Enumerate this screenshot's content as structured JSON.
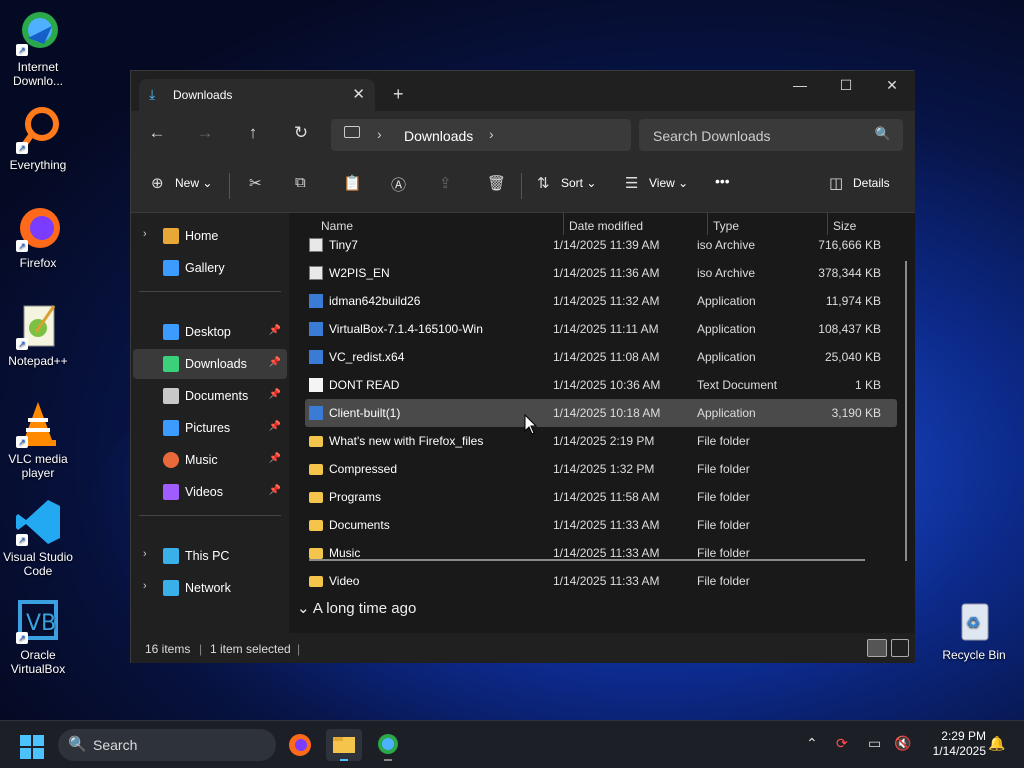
{
  "desktop": {
    "icons": [
      {
        "label": "Internet Downlo...",
        "icon": "internet-download-manager-icon"
      },
      {
        "label": "Everything",
        "icon": "everything-search-icon"
      },
      {
        "label": "Firefox",
        "icon": "firefox-icon"
      },
      {
        "label": "Notepad++",
        "icon": "notepad-plus-plus-icon"
      },
      {
        "label": "VLC media player",
        "icon": "vlc-icon"
      },
      {
        "label": "Visual Studio Code",
        "icon": "vscode-icon"
      },
      {
        "label": "Oracle VirtualBox",
        "icon": "virtualbox-icon"
      },
      {
        "label": "Recycle Bin",
        "icon": "recycle-bin-icon"
      }
    ]
  },
  "window": {
    "tab_title": "Downloads",
    "new_tab": "+",
    "address": {
      "root_icon": "this-pc-icon",
      "crumb": "Downloads"
    },
    "search_placeholder": "Search Downloads",
    "toolbar": {
      "new_label": "New",
      "sort_label": "Sort",
      "view_label": "View",
      "details_label": "Details",
      "more": "•••"
    },
    "sidebar": {
      "home": "Home",
      "gallery": "Gallery",
      "pinned": [
        {
          "label": "Desktop",
          "color": "#3b9bff"
        },
        {
          "label": "Downloads",
          "color": "#3bd17a",
          "selected": true
        },
        {
          "label": "Documents",
          "color": "#c8c8c8"
        },
        {
          "label": "Pictures",
          "color": "#3b9bff"
        },
        {
          "label": "Music",
          "color": "#e86a3b"
        },
        {
          "label": "Videos",
          "color": "#a05cff"
        }
      ],
      "this_pc": "This PC",
      "network": "Network"
    },
    "columns": {
      "name": "Name",
      "date": "Date modified",
      "type": "Type",
      "size": "Size"
    },
    "files": [
      {
        "name": "Tiny7",
        "date": "1/14/2025 11:39 AM",
        "type": "iso Archive",
        "size": "716,666 KB",
        "kind": "iso"
      },
      {
        "name": "W2PIS_EN",
        "date": "1/14/2025 11:36 AM",
        "type": "iso Archive",
        "size": "378,344 KB",
        "kind": "iso"
      },
      {
        "name": "idman642build26",
        "date": "1/14/2025 11:32 AM",
        "type": "Application",
        "size": "11,974 KB",
        "kind": "app"
      },
      {
        "name": "VirtualBox-7.1.4-165100-Win",
        "date": "1/14/2025 11:11 AM",
        "type": "Application",
        "size": "108,437 KB",
        "kind": "app"
      },
      {
        "name": "VC_redist.x64",
        "date": "1/14/2025 11:08 AM",
        "type": "Application",
        "size": "25,040 KB",
        "kind": "app"
      },
      {
        "name": "DONT READ",
        "date": "1/14/2025 10:36 AM",
        "type": "Text Document",
        "size": "1 KB",
        "kind": "txt"
      },
      {
        "name": "Client-built(1)",
        "date": "1/14/2025 10:18 AM",
        "type": "Application",
        "size": "3,190 KB",
        "kind": "app",
        "selected": true
      },
      {
        "name": "What's new with Firefox_files",
        "date": "1/14/2025 2:19 PM",
        "type": "File folder",
        "size": "",
        "kind": "folder"
      },
      {
        "name": "Compressed",
        "date": "1/14/2025 1:32 PM",
        "type": "File folder",
        "size": "",
        "kind": "folder"
      },
      {
        "name": "Programs",
        "date": "1/14/2025 11:58 AM",
        "type": "File folder",
        "size": "",
        "kind": "folder"
      },
      {
        "name": "Documents",
        "date": "1/14/2025 11:33 AM",
        "type": "File folder",
        "size": "",
        "kind": "folder"
      },
      {
        "name": "Music",
        "date": "1/14/2025 11:33 AM",
        "type": "File folder",
        "size": "",
        "kind": "folder"
      },
      {
        "name": "Video",
        "date": "1/14/2025 11:33 AM",
        "type": "File folder",
        "size": "",
        "kind": "folder"
      }
    ],
    "group_header": "A long time ago",
    "status": {
      "items": "16 items",
      "selected": "1 item selected"
    }
  },
  "taskbar": {
    "search_placeholder": "Search",
    "apps": [
      "firefox-icon",
      "file-explorer-icon",
      "internet-download-manager-icon"
    ],
    "time": "2:29 PM",
    "date": "1/14/2025"
  }
}
